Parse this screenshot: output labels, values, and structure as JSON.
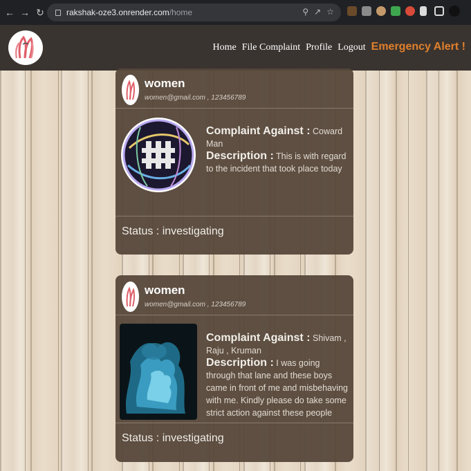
{
  "browser": {
    "url_host": "rakshak-oze3.onrender.com",
    "url_path": "/home"
  },
  "site": {
    "nav": {
      "home": "Home",
      "file_complaint": "File Complaint",
      "profile": "Profile",
      "logout": "Logout",
      "emergency": "Emergency Alert !"
    }
  },
  "complaints": [
    {
      "user": "women",
      "contact": "women@gmail.com , 123456789",
      "against_label": "Complaint Against :",
      "against": "Coward Man",
      "description_label": "Description :",
      "description": "This is with regard to the incident that took place today",
      "status": "Status : investigating"
    },
    {
      "user": "women",
      "contact": "women@gmail.com , 123456789",
      "against_label": "Complaint Against :",
      "against": "Shivam , Raju , Kruman",
      "description_label": "Description :",
      "description": "I was going through that lane and these boys came in front of me and misbehaving with me. Kindly please do take some strict action against these people",
      "status": "Status : investigating"
    }
  ],
  "colors": {
    "header_bg": "#3a3430",
    "card_bg": "#554639",
    "emergency": "#e0802c"
  }
}
